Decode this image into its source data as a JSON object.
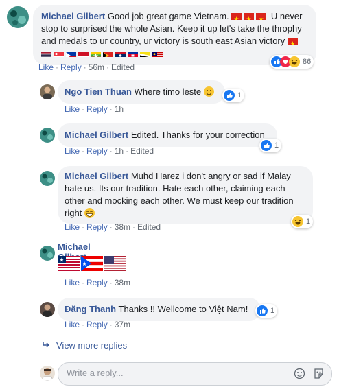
{
  "comments": [
    {
      "author": "Michael Gilbert",
      "text_1": "Good job great game Vietnam.",
      "text_2": "U never stop to surprised the whole Asian. Keep it up let's take the throphy and medals to ur country, ur victory is south east Asian victory",
      "actions": {
        "like": "Like",
        "reply": "Reply",
        "time": "56m",
        "edited": "Edited"
      },
      "reaction_count": "86"
    },
    {
      "author": "Ngo Tien Thuan",
      "text": "Where timo leste",
      "actions": {
        "like": "Like",
        "reply": "Reply",
        "time": "1h"
      },
      "reaction_count": "1"
    },
    {
      "author": "Michael Gilbert",
      "text": "Edited. Thanks for your correction",
      "actions": {
        "like": "Like",
        "reply": "Reply",
        "time": "1h",
        "edited": "Edited"
      },
      "reaction_count": "1"
    },
    {
      "author": "Michael Gilbert",
      "text": "Muhd Harez i don't angry or sad if Malay hate us. Its our tradition. Hate each other, claiming each other and mocking each other. We must keep our tradition right",
      "actions": {
        "like": "Like",
        "reply": "Reply",
        "time": "38m",
        "edited": "Edited"
      },
      "reaction_count": "1"
    },
    {
      "author": "Michael Gilbert",
      "actions": {
        "like": "Like",
        "reply": "Reply",
        "time": "38m"
      }
    },
    {
      "author": "Đăng Thanh",
      "text": "Thanks !! Wellcome to Việt Nam!",
      "actions": {
        "like": "Like",
        "reply": "Reply",
        "time": "37m"
      },
      "reaction_count": "1"
    }
  ],
  "view_more": "View more replies",
  "reply_input": {
    "placeholder": "Write a reply..."
  },
  "colors": {
    "link": "#385898",
    "action": "#4267b2",
    "bubble": "#f2f3f5",
    "like": "#1877f2",
    "love": "#f0284a",
    "haha": "#f7c531"
  },
  "icons": [
    "like-reaction-icon",
    "love-reaction-icon",
    "haha-reaction-icon",
    "smile-emoji-icon",
    "grin-emoji-icon",
    "reply-arrow-icon",
    "emoji-picker-icon",
    "sticker-icon"
  ]
}
